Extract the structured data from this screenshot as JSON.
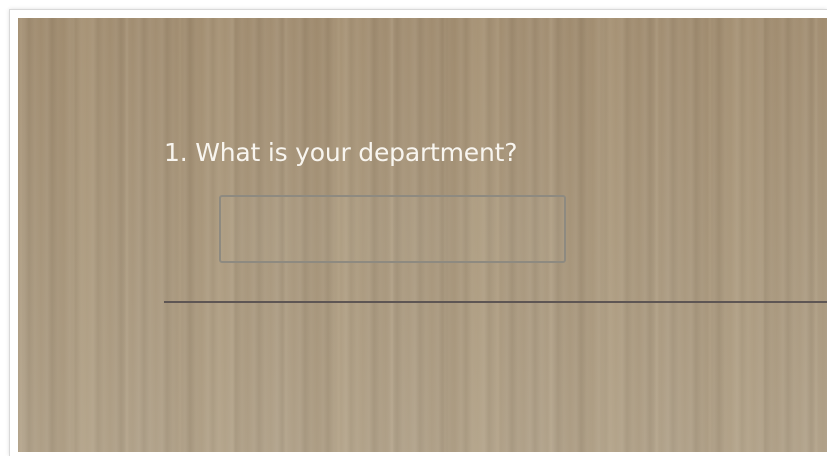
{
  "survey": {
    "question_text": "1. What is your department?",
    "answer_value": "",
    "answer_placeholder": ""
  },
  "colors": {
    "background_wood": "#a79479",
    "question_text": "#f8f5ef",
    "input_border": "#8e8a80",
    "divider": "#5e5654"
  }
}
